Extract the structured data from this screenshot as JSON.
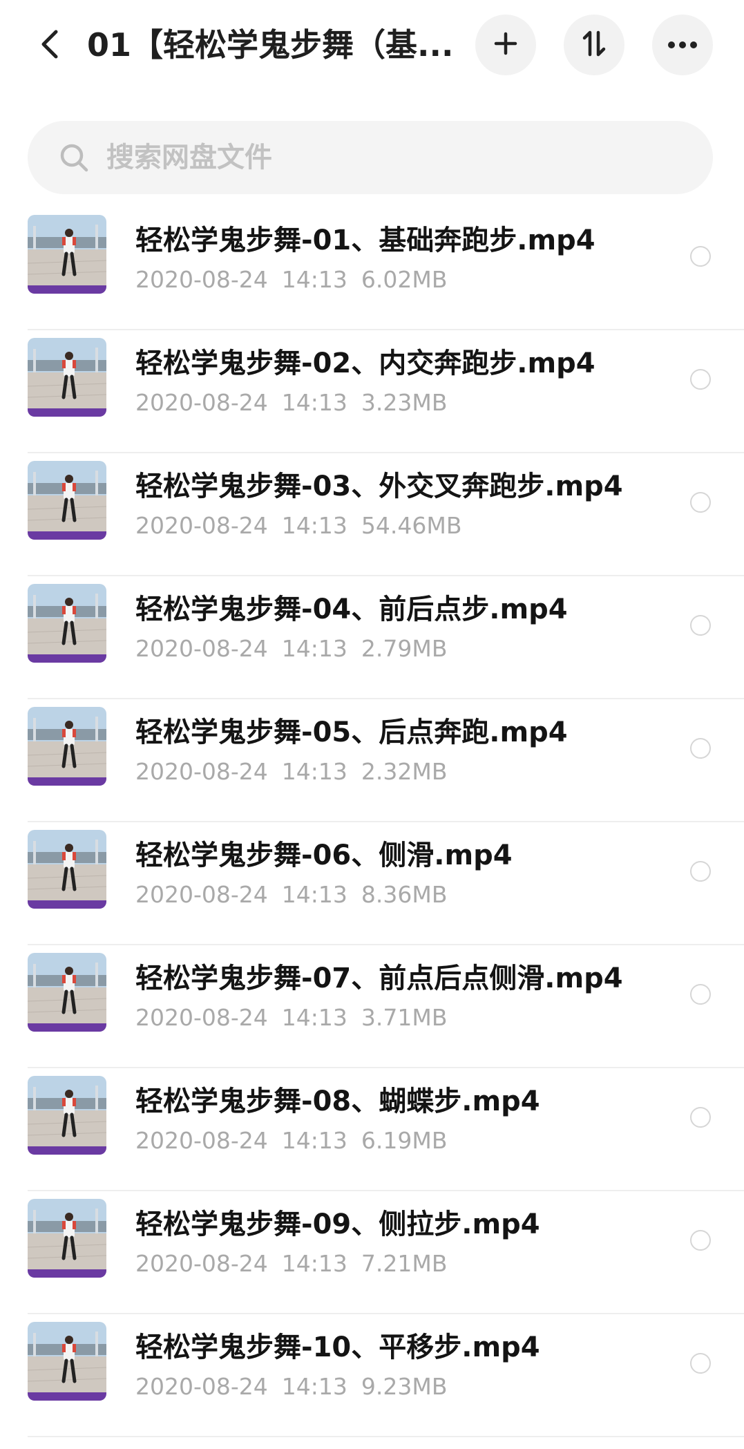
{
  "header": {
    "title": "01【轻松学鬼步舞（基...",
    "back_icon": "chevron-left-icon",
    "add_icon": "plus-icon",
    "sort_icon": "sort-icon",
    "more_icon": "more-icon"
  },
  "search": {
    "placeholder": "搜索网盘文件"
  },
  "files": [
    {
      "name": "轻松学鬼步舞-01、基础奔跑步.mp4",
      "date": "2020-08-24",
      "time": "14:13",
      "size": "6.02MB"
    },
    {
      "name": "轻松学鬼步舞-02、内交奔跑步.mp4",
      "date": "2020-08-24",
      "time": "14:13",
      "size": "3.23MB"
    },
    {
      "name": "轻松学鬼步舞-03、外交叉奔跑步.mp4",
      "date": "2020-08-24",
      "time": "14:13",
      "size": "54.46MB"
    },
    {
      "name": "轻松学鬼步舞-04、前后点步.mp4",
      "date": "2020-08-24",
      "time": "14:13",
      "size": "2.79MB"
    },
    {
      "name": "轻松学鬼步舞-05、后点奔跑.mp4",
      "date": "2020-08-24",
      "time": "14:13",
      "size": "2.32MB"
    },
    {
      "name": "轻松学鬼步舞-06、侧滑.mp4",
      "date": "2020-08-24",
      "time": "14:13",
      "size": "8.36MB"
    },
    {
      "name": "轻松学鬼步舞-07、前点后点侧滑.mp4",
      "date": "2020-08-24",
      "time": "14:13",
      "size": "3.71MB"
    },
    {
      "name": "轻松学鬼步舞-08、蝴蝶步.mp4",
      "date": "2020-08-24",
      "time": "14:13",
      "size": "6.19MB"
    },
    {
      "name": "轻松学鬼步舞-09、侧拉步.mp4",
      "date": "2020-08-24",
      "time": "14:13",
      "size": "7.21MB"
    },
    {
      "name": "轻松学鬼步舞-10、平移步.mp4",
      "date": "2020-08-24",
      "time": "14:13",
      "size": "9.23MB"
    }
  ],
  "colors": {
    "accent": "#6a3aa2",
    "meta_text": "#a9a9a9",
    "button_bg": "#f2f2f2"
  }
}
